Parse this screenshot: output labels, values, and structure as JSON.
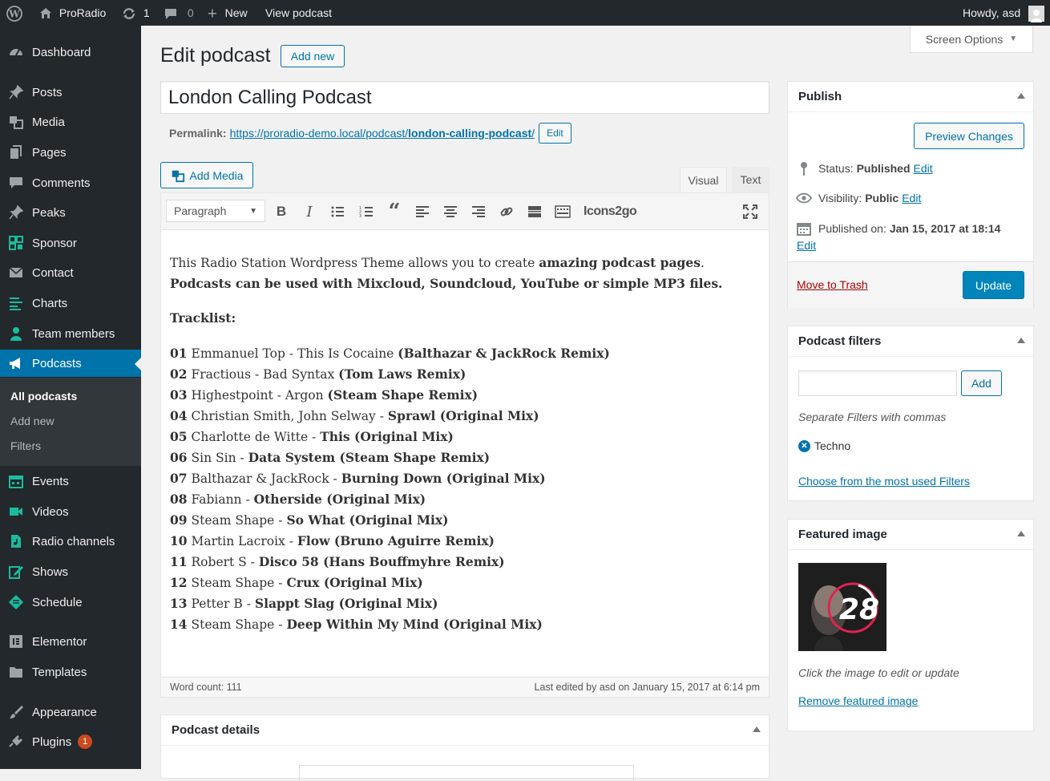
{
  "adminbar": {
    "site_name": "ProRadio",
    "updates_count": "1",
    "comments_count": "0",
    "new_label": "New",
    "view_label": "View podcast",
    "howdy": "Howdy, asd"
  },
  "sidebar": {
    "items": [
      {
        "label": "Dashboard",
        "icon": "dashboard-icon"
      },
      {
        "label": "Posts",
        "icon": "pin-icon"
      },
      {
        "label": "Media",
        "icon": "media-icon"
      },
      {
        "label": "Pages",
        "icon": "pages-icon"
      },
      {
        "label": "Comments",
        "icon": "comment-icon"
      },
      {
        "label": "Peaks",
        "icon": "pin-icon"
      },
      {
        "label": "Sponsor",
        "icon": "qrcode-icon"
      },
      {
        "label": "Contact",
        "icon": "mail-icon"
      },
      {
        "label": "Charts",
        "icon": "charts-icon"
      },
      {
        "label": "Team members",
        "icon": "person-icon"
      },
      {
        "label": "Podcasts",
        "icon": "megaphone-icon"
      },
      {
        "label": "Events",
        "icon": "calendar-icon"
      },
      {
        "label": "Videos",
        "icon": "video-icon"
      },
      {
        "label": "Radio channels",
        "icon": "audio-file-icon"
      },
      {
        "label": "Shows",
        "icon": "edit-icon"
      },
      {
        "label": "Schedule",
        "icon": "schedule-icon"
      },
      {
        "label": "Elementor",
        "icon": "elementor-icon"
      },
      {
        "label": "Templates",
        "icon": "folder-icon"
      },
      {
        "label": "Appearance",
        "icon": "brush-icon"
      },
      {
        "label": "Plugins",
        "icon": "plugin-icon",
        "badge": "1"
      }
    ],
    "submenu": [
      "All podcasts",
      "Add new",
      "Filters"
    ]
  },
  "screen_options": "Screen Options",
  "page": {
    "title": "Edit podcast",
    "add_new": "Add new",
    "post_title": "London Calling Podcast",
    "permalink_label": "Permalink:",
    "permalink_base": "https://proradio-demo.local/podcast/",
    "permalink_slug": "london-calling-podcast",
    "permalink_end": "/",
    "edit_btn": "Edit"
  },
  "editor": {
    "add_media": "Add Media",
    "tab_visual": "Visual",
    "tab_text": "Text",
    "format": "Paragraph",
    "icons2go": "Icons2go",
    "intro_plain": "This Radio Station Wordpress Theme allows you to create ",
    "intro_bold": "amazing podcast pages",
    "intro_end": ".",
    "intro_line2": "Podcasts can be used with Mixcloud, Soundcloud, YouTube or simple MP3 files.",
    "tracklist_heading": "Tracklist:",
    "tracks": [
      {
        "num": "01",
        "artist": "Emmanuel Top - This Is Cocaine ",
        "title": "(Balthazar & JackRock Remix)"
      },
      {
        "num": "02",
        "artist": "Fractious - Bad Syntax ",
        "title": "(Tom Laws Remix)"
      },
      {
        "num": "03",
        "artist": "Highestpoint - Argon ",
        "title": "(Steam Shape Remix)"
      },
      {
        "num": "04",
        "artist": "Christian Smith, John Selway - ",
        "title": "Sprawl (Original Mix)"
      },
      {
        "num": "05",
        "artist": "Charlotte de Witte - ",
        "title": "This (Original Mix)"
      },
      {
        "num": "06",
        "artist": "Sin Sin - ",
        "title": "Data System (Steam Shape Remix)"
      },
      {
        "num": "07",
        "artist": "Balthazar & JackRock - ",
        "title": "Burning Down (Original Mix)"
      },
      {
        "num": "08",
        "artist": "Fabiann - ",
        "title": "Otherside (Original Mix)"
      },
      {
        "num": "09",
        "artist": "Steam Shape - ",
        "title": "So What (Original Mix)"
      },
      {
        "num": "10",
        "artist": "Martin Lacroix - ",
        "title": "Flow (Bruno Aguirre Remix)"
      },
      {
        "num": "11",
        "artist": "Robert S - ",
        "title": "Disco 58 (Hans Bouffmyhre Remix)"
      },
      {
        "num": "12",
        "artist": "Steam Shape - ",
        "title": "Crux (Original Mix)"
      },
      {
        "num": "13",
        "artist": "Petter B - ",
        "title": "Slappt Slag (Original Mix)"
      },
      {
        "num": "14",
        "artist": "Steam Shape - ",
        "title": "Deep Within My Mind (Original Mix)"
      }
    ],
    "word_count": "Word count: 111",
    "last_edited": "Last edited by asd on January 15, 2017 at 6:14 pm"
  },
  "podcast_details": {
    "title": "Podcast details"
  },
  "publish": {
    "title": "Publish",
    "preview": "Preview Changes",
    "status_label": "Status:",
    "status_value": "Published",
    "visibility_label": "Visibility:",
    "visibility_value": "Public",
    "published_label": "Published on:",
    "published_value": "Jan 15, 2017 at 18:14",
    "edit": "Edit",
    "trash": "Move to Trash",
    "update": "Update"
  },
  "filters": {
    "title": "Podcast filters",
    "input_value": "",
    "add": "Add",
    "hint": "Separate Filters with commas",
    "tag": "Techno",
    "choose": "Choose from the most used Filters"
  },
  "featured": {
    "title": "Featured image",
    "thumb_number": "28",
    "note": "Click the image to edit or update",
    "remove": "Remove featured image"
  },
  "colors": {
    "accent": "#0073aa",
    "sidebar": "#23282d",
    "primary_button": "#0085ba",
    "trash": "#a00"
  }
}
